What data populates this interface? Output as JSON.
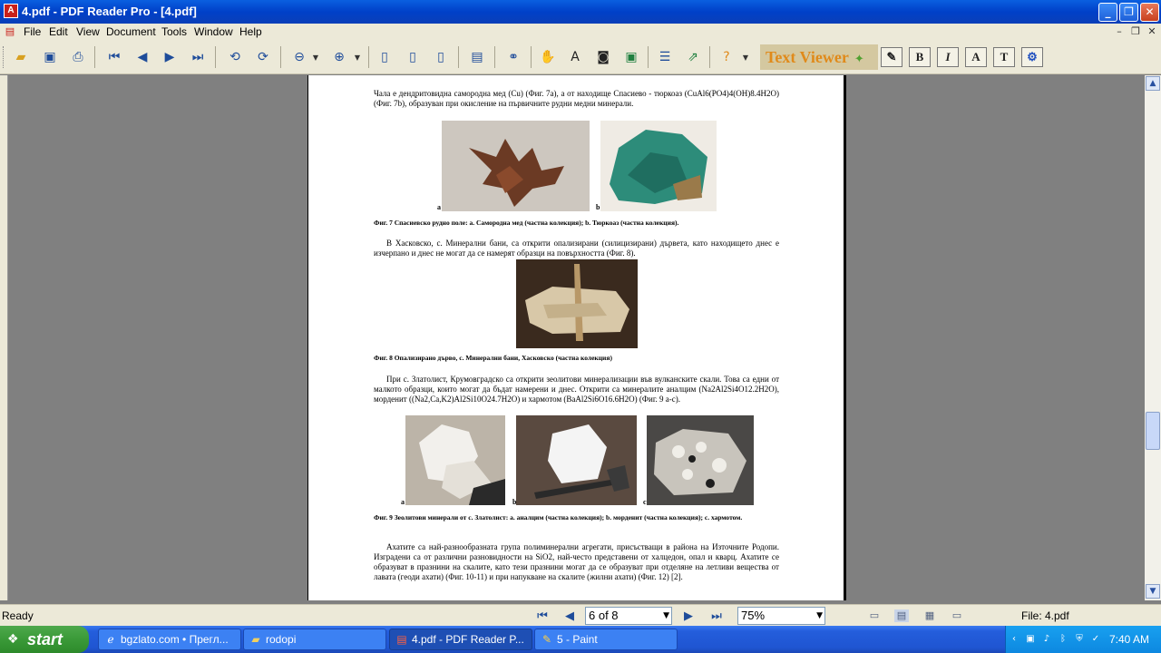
{
  "window": {
    "title": "4.pdf - PDF Reader Pro - [4.pdf]",
    "app_icon": "pdf-icon",
    "controls": [
      "minimize-icon",
      "restore-icon",
      "close-icon"
    ]
  },
  "menu": {
    "items": [
      "File",
      "Edit",
      "View",
      "Document",
      "Tools",
      "Window",
      "Help"
    ]
  },
  "toolbar": {
    "text_viewer_label": "Text Viewer",
    "bold_label": "B",
    "italic_label": "I",
    "font_label": "A",
    "text_label": "T"
  },
  "document": {
    "para1": "Чала е дендритовидна самородна мед (Cu) (Фиг. 7a), а от находище Спасиево - тюркоаз (CuAl6(PO4)4(OH)8.4H2O) (Фиг. 7b), образуван при окисление на първичните рудни медни минерали.",
    "fig7_label_a": "a",
    "fig7_label_b": "b",
    "fig7_caption": "Фиг. 7 Спасиевско рудно поле: a. Самородна мед (частна колекция); b. Тюркоаз (частна колекция).",
    "para2": "В Хасковско, с. Минерални бани, са открити опализирани (силицизирани) дървета, като находището днес е изчерпано и днес не могат да се намерят образци на повърхността (Фиг. 8).",
    "fig8_caption": "Фиг. 8 Опализирано дърво, с. Минерални бани, Хасковско (частна колекция)",
    "para3": "При с. Златолист, Крумовградско са открити зеолитови минерализации във вулканските скали. Това са едни от малкото образци, които могат да бъдат намерени и днес. Открити са минералите аналцим (Na2Al2Si4O12.2H2O), морденит ((Na2,Ca,K2)Al2Si10O24.7H2O) и хармотом (BaAl2Si6O16.6H2O) (Фиг. 9 а-с).",
    "fig9_label_a": "a",
    "fig9_label_b": "b",
    "fig9_label_c": "c",
    "fig9_caption": "Фиг. 9 Зеолитови минерали от с. Златолист: a. аналцим (частна колекция); b. морденит (частна колекция); c. хармотом.",
    "para4": "Ахатите са най-разнообразната група полиминерални агрегати, присъстващи в района на Източните Родопи. Изградени са от различни разновидности на SiO2, най-често представени от халцедон, опал и кварц. Ахатите се образуват в празнини на скалите, като тези празнини могат да се образуват при отделяне на летливи вещества от лавата (геоди ахати) (Фиг. 10-11) и при напукване на скалите (жилни ахати) (Фиг. 12) [2]."
  },
  "status": {
    "state": "Ready",
    "page_indicator": "6 of 8",
    "zoom": "75%",
    "file_label": "File: 4.pdf"
  },
  "taskbar": {
    "start_label": "start",
    "tasks": [
      {
        "label": "bgzlato.com • Прегл...",
        "icon": "browser-icon"
      },
      {
        "label": "rodopi",
        "icon": "folder-icon"
      },
      {
        "label": "4.pdf - PDF Reader P...",
        "icon": "pdf-icon"
      },
      {
        "label": "5 - Paint",
        "icon": "paint-icon"
      }
    ],
    "clock": "7:40 AM"
  },
  "colors": {
    "titlebar": "#0040c8",
    "chrome": "#ece9d8",
    "workspace": "#808080",
    "taskbar": "#245edc",
    "start": "#3a9a38",
    "tray": "#0d88e0"
  }
}
